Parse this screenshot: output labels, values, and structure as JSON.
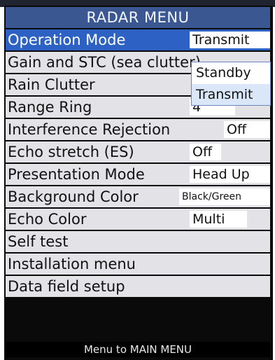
{
  "title": "RADAR MENU",
  "rows": [
    {
      "label": "Operation Mode",
      "value": "Transmit"
    },
    {
      "label": "Gain and STC (sea clutter)"
    },
    {
      "label": "Rain Clutter"
    },
    {
      "label": "Range Ring",
      "value": "4"
    },
    {
      "label": "Interference Rejection",
      "value": "Off"
    },
    {
      "label": "Echo stretch (ES)",
      "value": "Off"
    },
    {
      "label": "Presentation Mode",
      "value": "Head Up"
    },
    {
      "label": "Background Color",
      "value": "Black/Green"
    },
    {
      "label": "Echo Color",
      "value": "Multi"
    },
    {
      "label": "Self test"
    },
    {
      "label": "Installation menu"
    },
    {
      "label": "Data field setup"
    }
  ],
  "dropdown": {
    "options": [
      "Standby",
      "Transmit"
    ]
  },
  "footer": "Menu to MAIN MENU",
  "colors": {
    "title_bar": "#3a5792",
    "selected_row": "#2d62c4",
    "row_bg": "#e3e2e6",
    "dropdown_highlight": "#d9e7f8"
  }
}
